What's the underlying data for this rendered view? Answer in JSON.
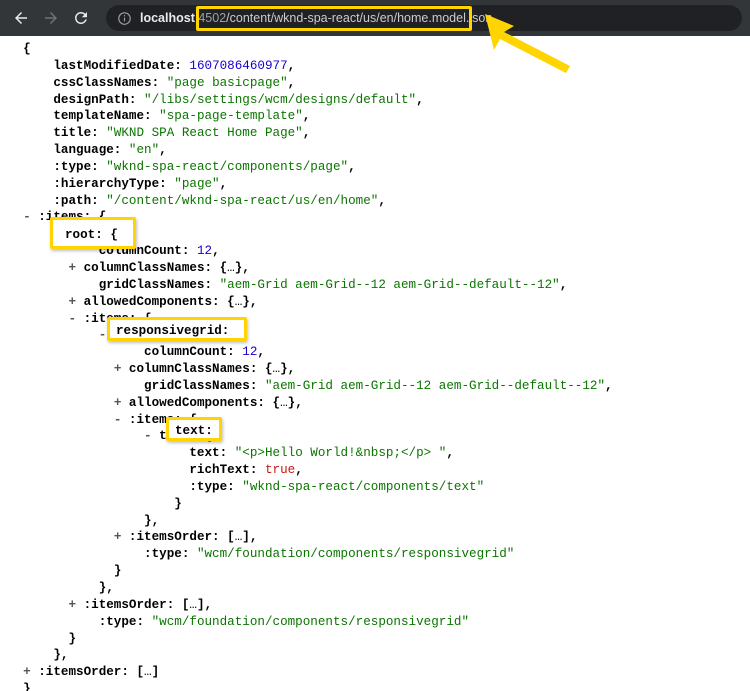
{
  "browser": {
    "back_label": "Back",
    "forward_label": "Forward",
    "reload_label": "Reload",
    "site_info_label": "View site information",
    "url": {
      "scheme_host": "localhost",
      "port": ":4502",
      "path": "/content/wknd-spa-react/us/en/home.model.json",
      "full": "localhost:4502/content/wknd-spa-react/us/en/home.model.json"
    }
  },
  "annotations": {
    "arrow_color": "#ffd400",
    "highlight_color": "#ffd400",
    "url_highlight_target": "/content/wknd-spa-react/us/en/home.model.json",
    "boxes": [
      {
        "label": "root: {",
        "target": "root"
      },
      {
        "label": "responsivegrid:",
        "target": "responsivegrid"
      },
      {
        "label": "text:",
        "target": "text"
      }
    ]
  },
  "json_lines": [
    {
      "indent": 0,
      "toggle": "",
      "segs": [
        {
          "t": "{",
          "c": "punc"
        }
      ]
    },
    {
      "indent": 4,
      "toggle": "",
      "segs": [
        {
          "t": "lastModifiedDate: ",
          "c": "key"
        },
        {
          "t": "1607086460977",
          "c": "num"
        },
        {
          "t": ",",
          "c": "punc"
        }
      ]
    },
    {
      "indent": 4,
      "toggle": "",
      "segs": [
        {
          "t": "cssClassNames: ",
          "c": "key"
        },
        {
          "t": "\"page basicpage\"",
          "c": "str"
        },
        {
          "t": ",",
          "c": "punc"
        }
      ]
    },
    {
      "indent": 4,
      "toggle": "",
      "segs": [
        {
          "t": "designPath: ",
          "c": "key"
        },
        {
          "t": "\"/libs/settings/wcm/designs/default\"",
          "c": "str"
        },
        {
          "t": ",",
          "c": "punc"
        }
      ]
    },
    {
      "indent": 4,
      "toggle": "",
      "segs": [
        {
          "t": "templateName: ",
          "c": "key"
        },
        {
          "t": "\"spa-page-template\"",
          "c": "str"
        },
        {
          "t": ",",
          "c": "punc"
        }
      ]
    },
    {
      "indent": 4,
      "toggle": "",
      "segs": [
        {
          "t": "title: ",
          "c": "key"
        },
        {
          "t": "\"WKND SPA React Home Page\"",
          "c": "str"
        },
        {
          "t": ",",
          "c": "punc"
        }
      ]
    },
    {
      "indent": 4,
      "toggle": "",
      "segs": [
        {
          "t": "language: ",
          "c": "key"
        },
        {
          "t": "\"en\"",
          "c": "str"
        },
        {
          "t": ",",
          "c": "punc"
        }
      ]
    },
    {
      "indent": 4,
      "toggle": "",
      "segs": [
        {
          "t": ":type: ",
          "c": "key"
        },
        {
          "t": "\"wknd-spa-react/components/page\"",
          "c": "str"
        },
        {
          "t": ",",
          "c": "punc"
        }
      ]
    },
    {
      "indent": 4,
      "toggle": "",
      "segs": [
        {
          "t": ":hierarchyType: ",
          "c": "key"
        },
        {
          "t": "\"page\"",
          "c": "str"
        },
        {
          "t": ",",
          "c": "punc"
        }
      ]
    },
    {
      "indent": 4,
      "toggle": "",
      "segs": [
        {
          "t": ":path: ",
          "c": "key"
        },
        {
          "t": "\"/content/wknd-spa-react/us/en/home\"",
          "c": "str"
        },
        {
          "t": ",",
          "c": "punc"
        }
      ]
    },
    {
      "indent": 2,
      "toggle": "-",
      "segs": [
        {
          "t": ":items: {",
          "c": "key"
        }
      ]
    },
    {
      "indent": 6,
      "toggle": "-",
      "segs": [
        {
          "t": "root: {",
          "c": "key"
        }
      ]
    },
    {
      "indent": 10,
      "toggle": "",
      "segs": [
        {
          "t": "columnCount: ",
          "c": "key"
        },
        {
          "t": "12",
          "c": "num"
        },
        {
          "t": ",",
          "c": "punc"
        }
      ]
    },
    {
      "indent": 8,
      "toggle": "+",
      "segs": [
        {
          "t": "columnClassNames: {",
          "c": "key"
        },
        {
          "t": "…",
          "c": "ellip"
        },
        {
          "t": "},",
          "c": "key"
        }
      ]
    },
    {
      "indent": 10,
      "toggle": "",
      "segs": [
        {
          "t": "gridClassNames: ",
          "c": "key"
        },
        {
          "t": "\"aem-Grid aem-Grid--12 aem-Grid--default--12\"",
          "c": "str"
        },
        {
          "t": ",",
          "c": "punc"
        }
      ]
    },
    {
      "indent": 8,
      "toggle": "+",
      "segs": [
        {
          "t": "allowedComponents: {",
          "c": "key"
        },
        {
          "t": "…",
          "c": "ellip"
        },
        {
          "t": "},",
          "c": "key"
        }
      ]
    },
    {
      "indent": 8,
      "toggle": "-",
      "segs": [
        {
          "t": ":items: {",
          "c": "key"
        }
      ]
    },
    {
      "indent": 12,
      "toggle": "-",
      "segs": [
        {
          "t": "responsivegrid: {",
          "c": "key"
        }
      ]
    },
    {
      "indent": 16,
      "toggle": "",
      "segs": [
        {
          "t": "columnCount: ",
          "c": "key"
        },
        {
          "t": "12",
          "c": "num"
        },
        {
          "t": ",",
          "c": "punc"
        }
      ]
    },
    {
      "indent": 14,
      "toggle": "+",
      "segs": [
        {
          "t": "columnClassNames: {",
          "c": "key"
        },
        {
          "t": "…",
          "c": "ellip"
        },
        {
          "t": "},",
          "c": "key"
        }
      ]
    },
    {
      "indent": 16,
      "toggle": "",
      "segs": [
        {
          "t": "gridClassNames: ",
          "c": "key"
        },
        {
          "t": "\"aem-Grid aem-Grid--12 aem-Grid--default--12\"",
          "c": "str"
        },
        {
          "t": ",",
          "c": "punc"
        }
      ]
    },
    {
      "indent": 14,
      "toggle": "+",
      "segs": [
        {
          "t": "allowedComponents: {",
          "c": "key"
        },
        {
          "t": "…",
          "c": "ellip"
        },
        {
          "t": "},",
          "c": "key"
        }
      ]
    },
    {
      "indent": 14,
      "toggle": "-",
      "segs": [
        {
          "t": ":items: {",
          "c": "key"
        }
      ]
    },
    {
      "indent": 18,
      "toggle": "-",
      "segs": [
        {
          "t": "text: {",
          "c": "key"
        }
      ]
    },
    {
      "indent": 22,
      "toggle": "",
      "segs": [
        {
          "t": "text: ",
          "c": "key"
        },
        {
          "t": "\"<p>Hello World!&nbsp;</p> \"",
          "c": "str"
        },
        {
          "t": ",",
          "c": "punc"
        }
      ]
    },
    {
      "indent": 22,
      "toggle": "",
      "segs": [
        {
          "t": "richText: ",
          "c": "key"
        },
        {
          "t": "true",
          "c": "bool"
        },
        {
          "t": ",",
          "c": "punc"
        }
      ]
    },
    {
      "indent": 22,
      "toggle": "",
      "segs": [
        {
          "t": ":type: ",
          "c": "key"
        },
        {
          "t": "\"wknd-spa-react/components/text\"",
          "c": "str"
        }
      ]
    },
    {
      "indent": 20,
      "toggle": "",
      "segs": [
        {
          "t": "}",
          "c": "punc"
        }
      ]
    },
    {
      "indent": 16,
      "toggle": "",
      "segs": [
        {
          "t": "},",
          "c": "punc"
        }
      ]
    },
    {
      "indent": 14,
      "toggle": "+",
      "segs": [
        {
          "t": ":itemsOrder: [",
          "c": "key"
        },
        {
          "t": "…",
          "c": "ellip"
        },
        {
          "t": "],",
          "c": "key"
        }
      ]
    },
    {
      "indent": 16,
      "toggle": "",
      "segs": [
        {
          "t": ":type: ",
          "c": "key"
        },
        {
          "t": "\"wcm/foundation/components/responsivegrid\"",
          "c": "str"
        }
      ]
    },
    {
      "indent": 12,
      "toggle": "",
      "segs": [
        {
          "t": "}",
          "c": "punc"
        }
      ]
    },
    {
      "indent": 10,
      "toggle": "",
      "segs": [
        {
          "t": "},",
          "c": "punc"
        }
      ]
    },
    {
      "indent": 8,
      "toggle": "+",
      "segs": [
        {
          "t": ":itemsOrder: [",
          "c": "key"
        },
        {
          "t": "…",
          "c": "ellip"
        },
        {
          "t": "],",
          "c": "key"
        }
      ]
    },
    {
      "indent": 10,
      "toggle": "",
      "segs": [
        {
          "t": ":type: ",
          "c": "key"
        },
        {
          "t": "\"wcm/foundation/components/responsivegrid\"",
          "c": "str"
        }
      ]
    },
    {
      "indent": 6,
      "toggle": "",
      "segs": [
        {
          "t": "}",
          "c": "punc"
        }
      ]
    },
    {
      "indent": 4,
      "toggle": "",
      "segs": [
        {
          "t": "},",
          "c": "punc"
        }
      ]
    },
    {
      "indent": 2,
      "toggle": "+",
      "segs": [
        {
          "t": ":itemsOrder: [",
          "c": "key"
        },
        {
          "t": "…",
          "c": "ellip"
        },
        {
          "t": "]",
          "c": "key"
        }
      ]
    },
    {
      "indent": 0,
      "toggle": "",
      "segs": [
        {
          "t": "}",
          "c": "punc"
        }
      ]
    }
  ]
}
